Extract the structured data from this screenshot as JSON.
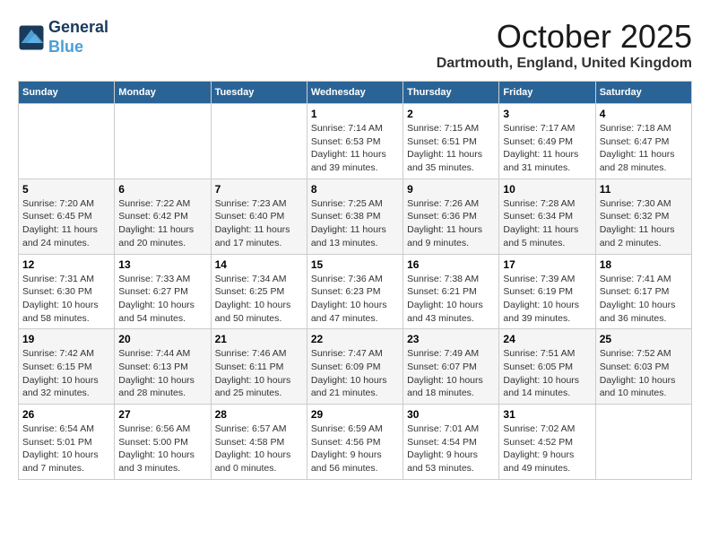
{
  "header": {
    "logo_line1": "General",
    "logo_line2": "Blue",
    "month": "October 2025",
    "location": "Dartmouth, England, United Kingdom"
  },
  "weekdays": [
    "Sunday",
    "Monday",
    "Tuesday",
    "Wednesday",
    "Thursday",
    "Friday",
    "Saturday"
  ],
  "weeks": [
    [
      {
        "day": "",
        "info": ""
      },
      {
        "day": "",
        "info": ""
      },
      {
        "day": "",
        "info": ""
      },
      {
        "day": "1",
        "info": "Sunrise: 7:14 AM\nSunset: 6:53 PM\nDaylight: 11 hours\nand 39 minutes."
      },
      {
        "day": "2",
        "info": "Sunrise: 7:15 AM\nSunset: 6:51 PM\nDaylight: 11 hours\nand 35 minutes."
      },
      {
        "day": "3",
        "info": "Sunrise: 7:17 AM\nSunset: 6:49 PM\nDaylight: 11 hours\nand 31 minutes."
      },
      {
        "day": "4",
        "info": "Sunrise: 7:18 AM\nSunset: 6:47 PM\nDaylight: 11 hours\nand 28 minutes."
      }
    ],
    [
      {
        "day": "5",
        "info": "Sunrise: 7:20 AM\nSunset: 6:45 PM\nDaylight: 11 hours\nand 24 minutes."
      },
      {
        "day": "6",
        "info": "Sunrise: 7:22 AM\nSunset: 6:42 PM\nDaylight: 11 hours\nand 20 minutes."
      },
      {
        "day": "7",
        "info": "Sunrise: 7:23 AM\nSunset: 6:40 PM\nDaylight: 11 hours\nand 17 minutes."
      },
      {
        "day": "8",
        "info": "Sunrise: 7:25 AM\nSunset: 6:38 PM\nDaylight: 11 hours\nand 13 minutes."
      },
      {
        "day": "9",
        "info": "Sunrise: 7:26 AM\nSunset: 6:36 PM\nDaylight: 11 hours\nand 9 minutes."
      },
      {
        "day": "10",
        "info": "Sunrise: 7:28 AM\nSunset: 6:34 PM\nDaylight: 11 hours\nand 5 minutes."
      },
      {
        "day": "11",
        "info": "Sunrise: 7:30 AM\nSunset: 6:32 PM\nDaylight: 11 hours\nand 2 minutes."
      }
    ],
    [
      {
        "day": "12",
        "info": "Sunrise: 7:31 AM\nSunset: 6:30 PM\nDaylight: 10 hours\nand 58 minutes."
      },
      {
        "day": "13",
        "info": "Sunrise: 7:33 AM\nSunset: 6:27 PM\nDaylight: 10 hours\nand 54 minutes."
      },
      {
        "day": "14",
        "info": "Sunrise: 7:34 AM\nSunset: 6:25 PM\nDaylight: 10 hours\nand 50 minutes."
      },
      {
        "day": "15",
        "info": "Sunrise: 7:36 AM\nSunset: 6:23 PM\nDaylight: 10 hours\nand 47 minutes."
      },
      {
        "day": "16",
        "info": "Sunrise: 7:38 AM\nSunset: 6:21 PM\nDaylight: 10 hours\nand 43 minutes."
      },
      {
        "day": "17",
        "info": "Sunrise: 7:39 AM\nSunset: 6:19 PM\nDaylight: 10 hours\nand 39 minutes."
      },
      {
        "day": "18",
        "info": "Sunrise: 7:41 AM\nSunset: 6:17 PM\nDaylight: 10 hours\nand 36 minutes."
      }
    ],
    [
      {
        "day": "19",
        "info": "Sunrise: 7:42 AM\nSunset: 6:15 PM\nDaylight: 10 hours\nand 32 minutes."
      },
      {
        "day": "20",
        "info": "Sunrise: 7:44 AM\nSunset: 6:13 PM\nDaylight: 10 hours\nand 28 minutes."
      },
      {
        "day": "21",
        "info": "Sunrise: 7:46 AM\nSunset: 6:11 PM\nDaylight: 10 hours\nand 25 minutes."
      },
      {
        "day": "22",
        "info": "Sunrise: 7:47 AM\nSunset: 6:09 PM\nDaylight: 10 hours\nand 21 minutes."
      },
      {
        "day": "23",
        "info": "Sunrise: 7:49 AM\nSunset: 6:07 PM\nDaylight: 10 hours\nand 18 minutes."
      },
      {
        "day": "24",
        "info": "Sunrise: 7:51 AM\nSunset: 6:05 PM\nDaylight: 10 hours\nand 14 minutes."
      },
      {
        "day": "25",
        "info": "Sunrise: 7:52 AM\nSunset: 6:03 PM\nDaylight: 10 hours\nand 10 minutes."
      }
    ],
    [
      {
        "day": "26",
        "info": "Sunrise: 6:54 AM\nSunset: 5:01 PM\nDaylight: 10 hours\nand 7 minutes."
      },
      {
        "day": "27",
        "info": "Sunrise: 6:56 AM\nSunset: 5:00 PM\nDaylight: 10 hours\nand 3 minutes."
      },
      {
        "day": "28",
        "info": "Sunrise: 6:57 AM\nSunset: 4:58 PM\nDaylight: 10 hours\nand 0 minutes."
      },
      {
        "day": "29",
        "info": "Sunrise: 6:59 AM\nSunset: 4:56 PM\nDaylight: 9 hours\nand 56 minutes."
      },
      {
        "day": "30",
        "info": "Sunrise: 7:01 AM\nSunset: 4:54 PM\nDaylight: 9 hours\nand 53 minutes."
      },
      {
        "day": "31",
        "info": "Sunrise: 7:02 AM\nSunset: 4:52 PM\nDaylight: 9 hours\nand 49 minutes."
      },
      {
        "day": "",
        "info": ""
      }
    ]
  ]
}
